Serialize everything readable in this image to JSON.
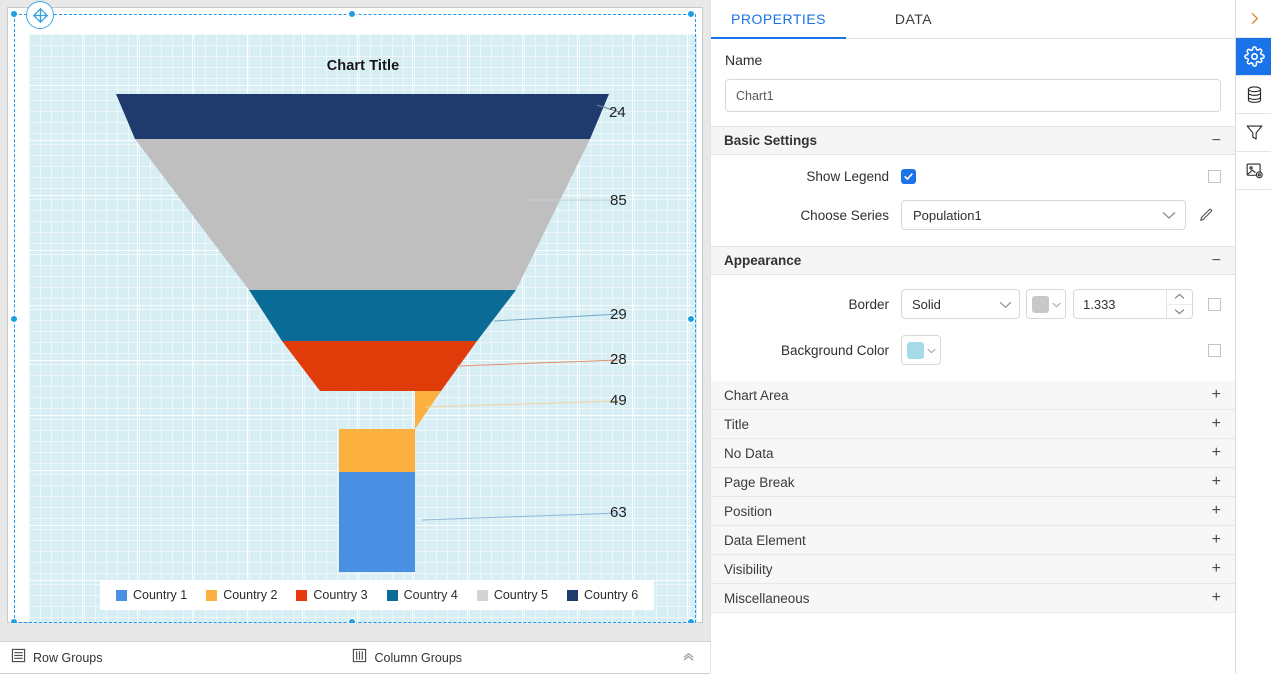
{
  "chart_data": {
    "type": "funnel",
    "title": "Chart Title",
    "categories": [
      "Country 6",
      "Country 5",
      "Country 4",
      "Country 3",
      "Country 2",
      "Country 1"
    ],
    "values": [
      24,
      85,
      29,
      28,
      49,
      63
    ],
    "labels": [
      "24",
      "85",
      "29",
      "28",
      "49",
      "63"
    ],
    "colors": [
      "#1f3b6e",
      "#bfbfbf",
      "#0a6b96",
      "#e03c0a",
      "#fcb040",
      "#4a90e2"
    ],
    "legend": {
      "position": "bottom",
      "entries": [
        {
          "label": "Country 1",
          "color": "#4a90e2"
        },
        {
          "label": "Country 2",
          "color": "#fcb040"
        },
        {
          "label": "Country 3",
          "color": "#e8380d"
        },
        {
          "label": "Country 4",
          "color": "#0a6b96"
        },
        {
          "label": "Country 5",
          "color": "#d3d3d3"
        },
        {
          "label": "Country 6",
          "color": "#1f3b6e"
        }
      ]
    },
    "plot_background": "#d6eef4",
    "grid": true
  },
  "designer": {
    "drag_handle_icon": "move-icon",
    "groups_bar": {
      "row_groups_label": "Row Groups",
      "row_groups_icon": "row-groups-icon",
      "column_groups_label": "Column Groups",
      "column_groups_icon": "column-groups-icon",
      "collapse_icon": "chevron-up-icon"
    }
  },
  "panel": {
    "tabs": [
      {
        "label": "PROPERTIES",
        "active": true
      },
      {
        "label": "DATA",
        "active": false
      }
    ],
    "name_field": {
      "label": "Name",
      "value": "Chart1",
      "placeholder": "Name"
    },
    "basic_settings": {
      "title": "Basic Settings",
      "toggle": "−",
      "show_legend": {
        "label": "Show Legend",
        "checked": true,
        "expression_checkbox": false
      },
      "choose_series": {
        "label": "Choose Series",
        "value": "Population1",
        "caret": "chevron-down-icon",
        "edit_icon": "pencil-icon"
      }
    },
    "appearance": {
      "title": "Appearance",
      "toggle": "−",
      "border": {
        "label": "Border",
        "style": "Solid",
        "color": "#c8c8c8",
        "width": "1.333",
        "expression_checkbox": false
      },
      "background_color": {
        "label": "Background Color",
        "color": "#a5dbe8",
        "expression_checkbox": false
      }
    },
    "collapsed_sections": [
      {
        "label": "Chart Area",
        "toggle": "+"
      },
      {
        "label": "Title",
        "toggle": "+"
      },
      {
        "label": "No Data",
        "toggle": "+"
      },
      {
        "label": "Page Break",
        "toggle": "+"
      },
      {
        "label": "Position",
        "toggle": "+"
      },
      {
        "label": "Data Element",
        "toggle": "+"
      },
      {
        "label": "Visibility",
        "toggle": "+"
      },
      {
        "label": "Miscellaneous",
        "toggle": "+"
      }
    ]
  },
  "icon_rail": {
    "expand_icon": "chevron-right-icon",
    "items": [
      {
        "name": "gear-icon",
        "active": true
      },
      {
        "name": "database-icon",
        "active": false
      },
      {
        "name": "filter-funnel-icon",
        "active": false
      },
      {
        "name": "image-settings-icon",
        "active": false
      }
    ]
  },
  "colors": {
    "accent": "#1a73e8",
    "panel_bg": "#ffffff",
    "designer_bg": "#e8e8e8",
    "section_bg": "#f5f5f5"
  }
}
